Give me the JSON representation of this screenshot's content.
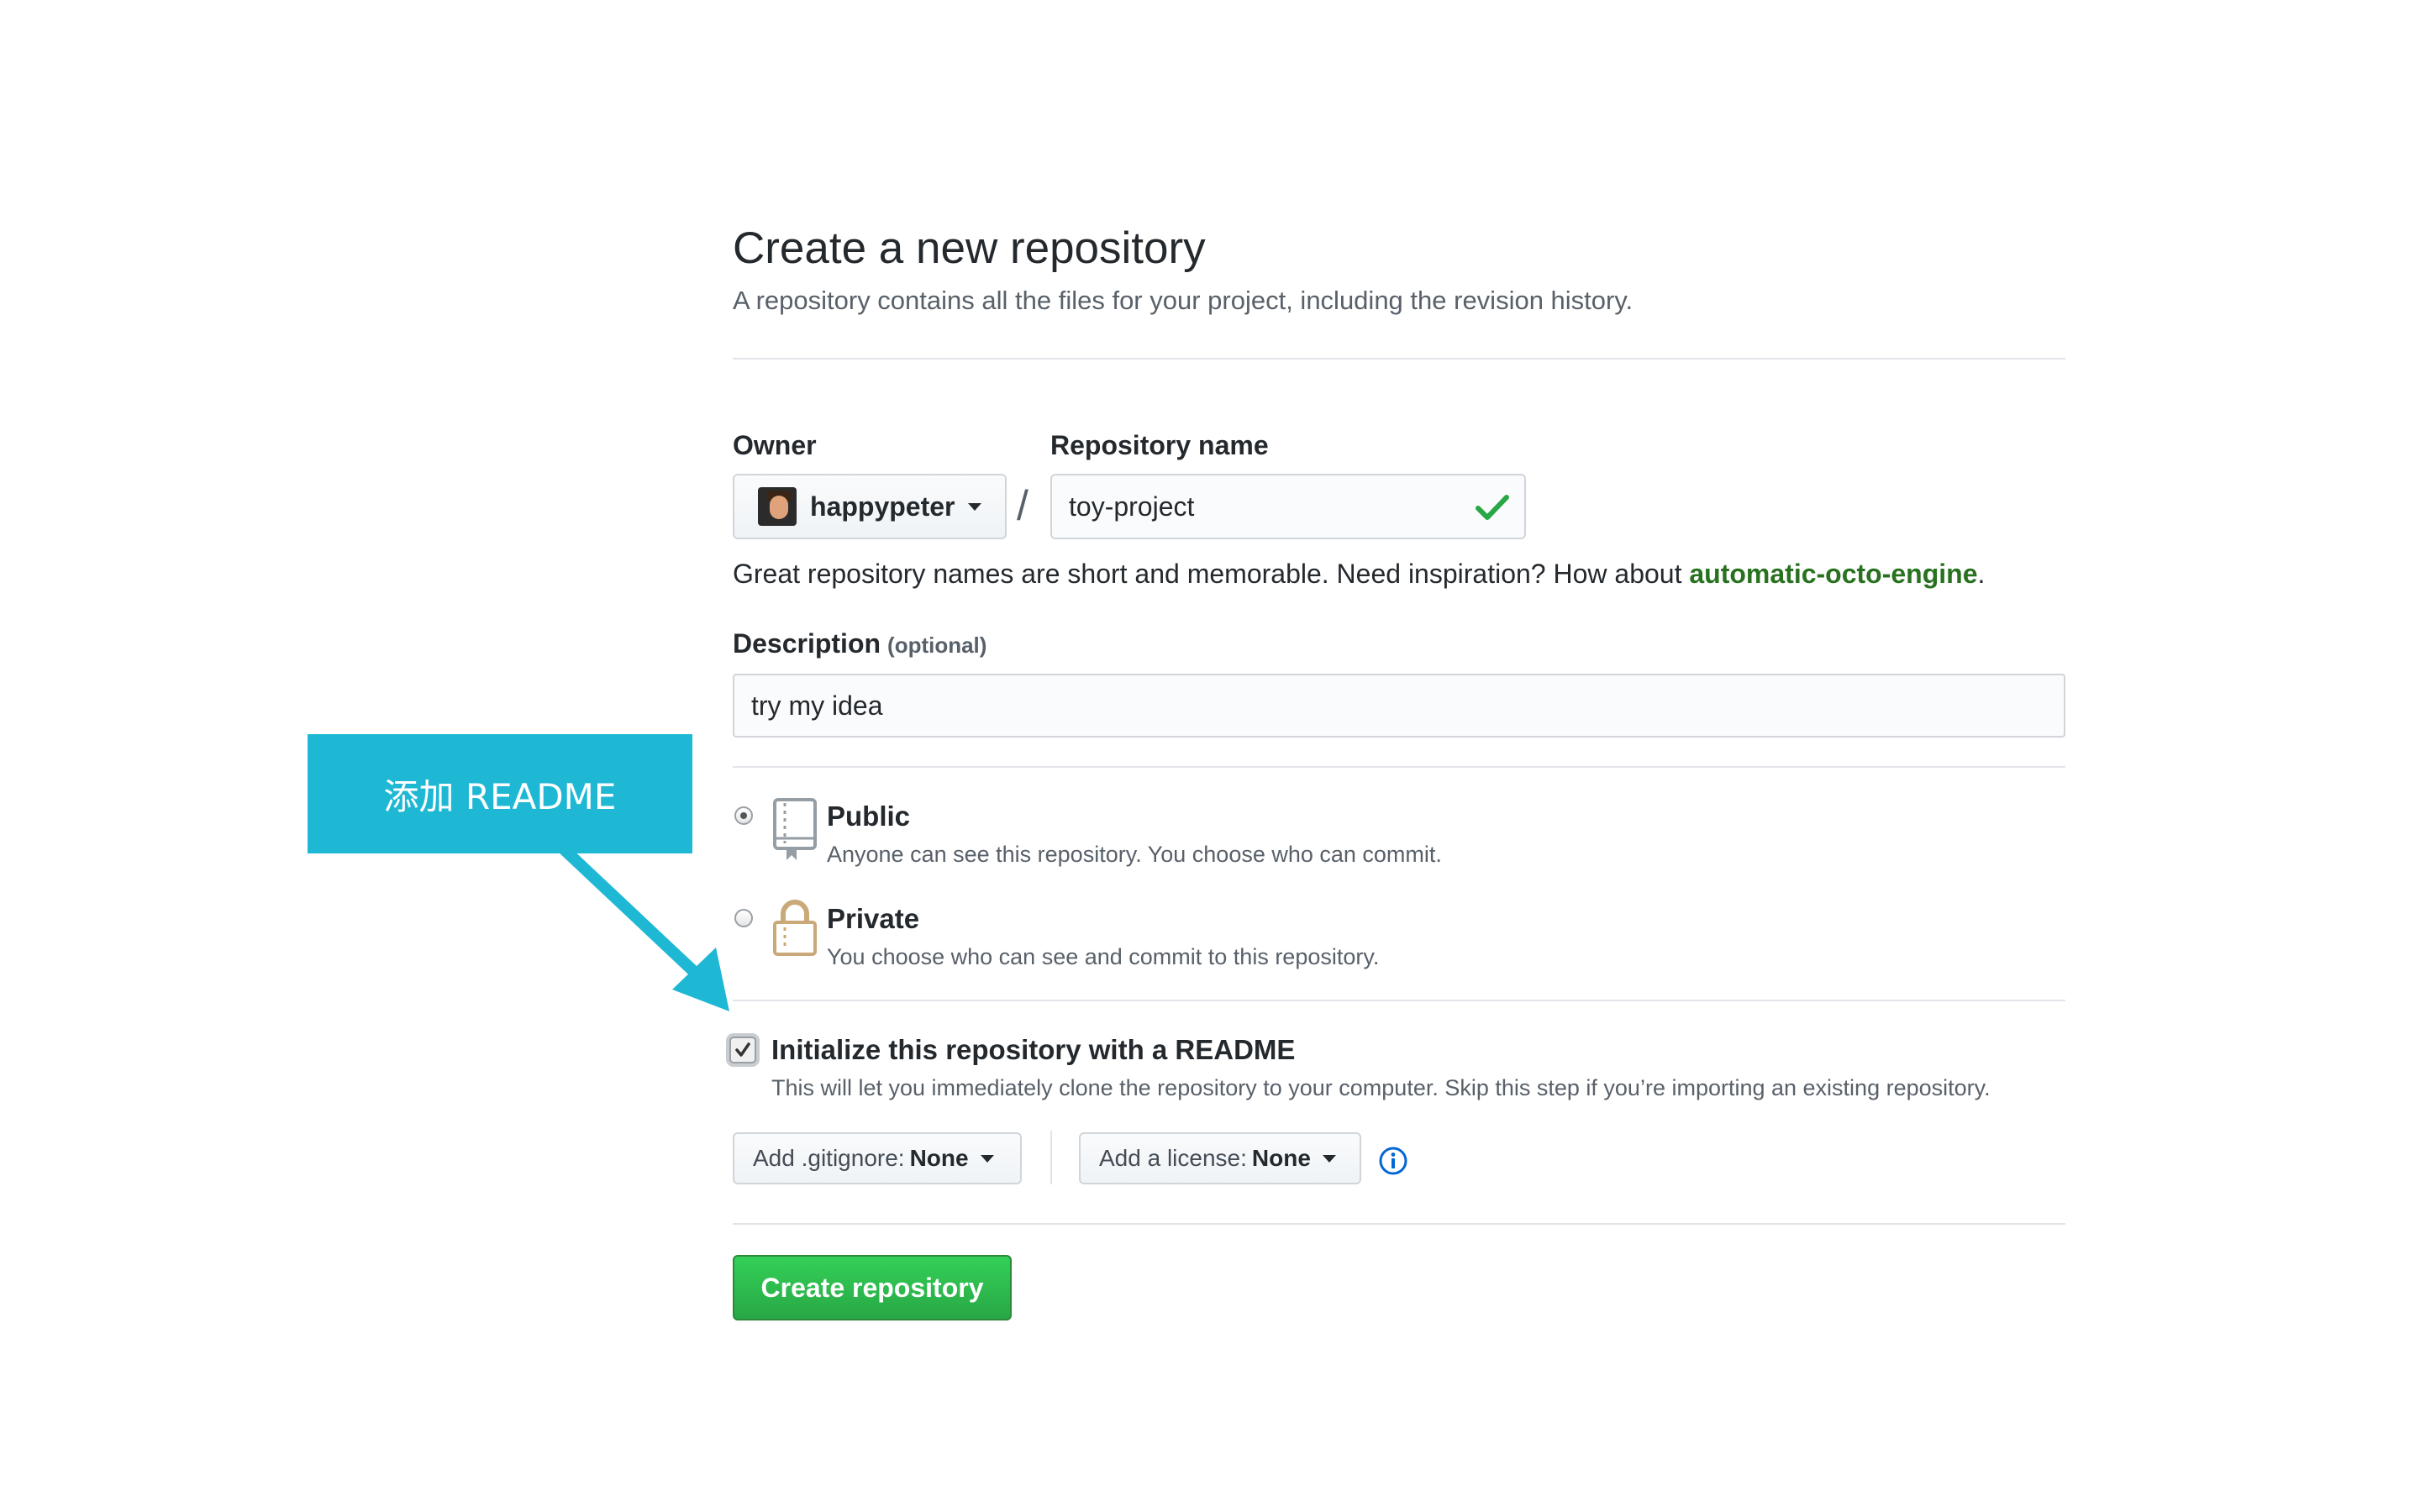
{
  "header": {
    "title": "Create a new repository",
    "subtitle": "A repository contains all the files for your project, including the revision history."
  },
  "form": {
    "owner_label": "Owner",
    "owner_value": "happypeter",
    "slash": "/",
    "repo_label": "Repository name",
    "repo_value": "toy-project",
    "hint_prefix": "Great repository names are short and memorable. Need inspiration? How about ",
    "hint_suggestion": "automatic-octo-engine",
    "hint_suffix": ".",
    "description_label": "Description",
    "description_optional": "(optional)",
    "description_value": "try my idea"
  },
  "visibility": {
    "selected": "Public",
    "public_title": "Public",
    "public_note": "Anyone can see this repository. You choose who can commit.",
    "private_title": "Private",
    "private_note": "You choose who can see and commit to this repository."
  },
  "init": {
    "checked": true,
    "title": "Initialize this repository with a README",
    "note": "This will let you immediately clone the repository to your computer. Skip this step if you’re importing an existing repository."
  },
  "extras": {
    "gitignore_prefix": "Add .gitignore:",
    "gitignore_value": "None",
    "license_prefix": "Add a license:",
    "license_value": "None"
  },
  "actions": {
    "create_label": "Create repository"
  },
  "annotation": {
    "text": "添加 README"
  },
  "colors": {
    "primary_button": "#28a745",
    "suggestion_link": "#28721f",
    "check_mark": "#28a745",
    "callout": "#1fb8d4",
    "info_icon": "#0366d6"
  },
  "icons": {
    "owner_caret": "chevron-down-icon",
    "repo_valid": "check-icon",
    "public": "repo-book-icon",
    "private": "lock-icon",
    "info": "info-icon",
    "annotation_arrow": "arrow-icon"
  }
}
